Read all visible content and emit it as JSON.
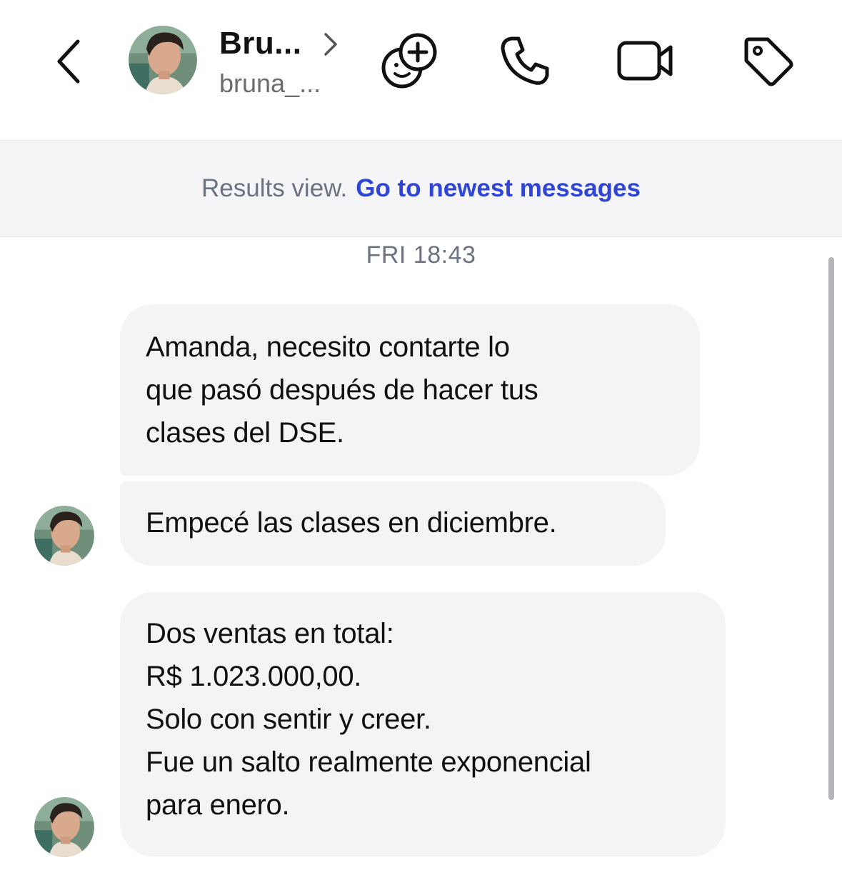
{
  "header": {
    "back_icon": "chevron-left-icon",
    "avatar_icon": "avatar-photo",
    "name": "Bru...",
    "name_chevron_icon": "chevron-right-icon",
    "username": "bruna_...",
    "actions": [
      {
        "name": "add-emoji-reaction",
        "icon": "smile-plus-icon"
      },
      {
        "name": "voice-call",
        "icon": "phone-icon"
      },
      {
        "name": "video-call",
        "icon": "video-camera-icon"
      },
      {
        "name": "label",
        "icon": "tag-icon"
      }
    ]
  },
  "banner": {
    "static_text": "Results view.",
    "link_text": "Go to newest messages",
    "link_color": "#2f45d6"
  },
  "thread": {
    "timestamp": "FRI 18:43",
    "messages": [
      {
        "lines": [
          "Amanda, necesito contarte lo",
          "que pasó después de hacer tus",
          "clases del DSE."
        ]
      },
      {
        "lines": [
          "Empecé las clases en diciembre."
        ]
      },
      {
        "lines": [
          "Dos ventas en total:",
          "R$ 1.023.000,00.",
          "Solo con sentir y creer.",
          "Fue un salto realmente exponencial",
          "para enero."
        ]
      }
    ]
  },
  "colors": {
    "bubble_bg": "#f3f4f6",
    "banner_bg": "#f5f5f7",
    "muted_text": "#6b7280"
  }
}
